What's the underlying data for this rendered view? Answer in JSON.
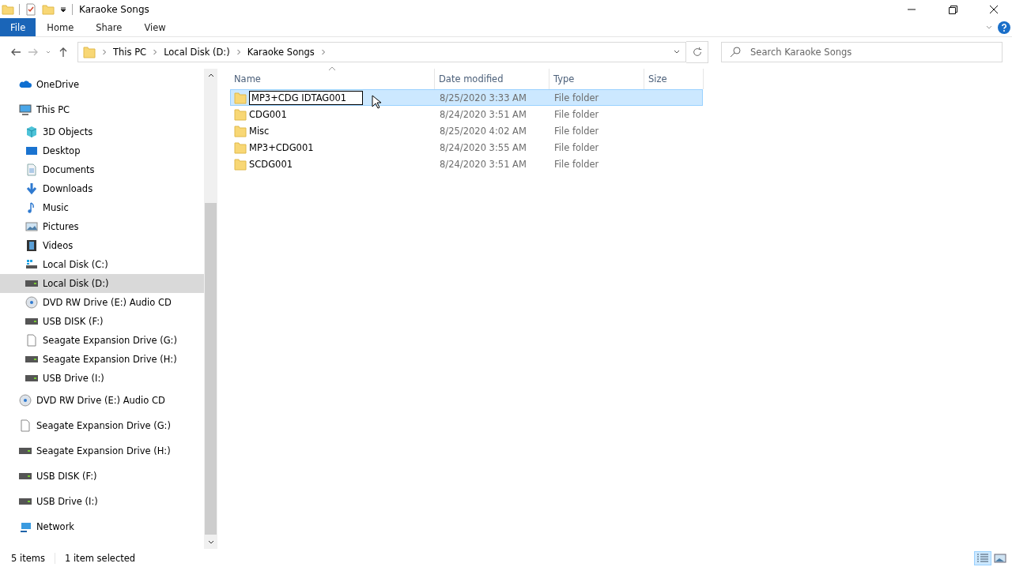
{
  "window": {
    "title": "Karaoke Songs"
  },
  "ribbon_tabs": [
    {
      "label": "File",
      "selected": true
    },
    {
      "label": "Home",
      "selected": false
    },
    {
      "label": "Share",
      "selected": false
    },
    {
      "label": "View",
      "selected": false
    }
  ],
  "address": {
    "path": [
      "This PC",
      "Local Disk (D:)",
      "Karaoke Songs"
    ]
  },
  "search": {
    "placeholder": "Search Karaoke Songs"
  },
  "sidebar": {
    "items": [
      {
        "label": "OneDrive",
        "kind": "cloud",
        "selected": false
      },
      {
        "label": "This PC",
        "kind": "computer",
        "selected": false,
        "children": [
          {
            "label": "3D Objects",
            "kind": "objects",
            "selected": false
          },
          {
            "label": "Desktop",
            "kind": "desktop",
            "selected": false
          },
          {
            "label": "Documents",
            "kind": "documents",
            "selected": false
          },
          {
            "label": "Downloads",
            "kind": "downloads",
            "selected": false
          },
          {
            "label": "Music",
            "kind": "music",
            "selected": false
          },
          {
            "label": "Pictures",
            "kind": "pictures",
            "selected": false
          },
          {
            "label": "Videos",
            "kind": "videos",
            "selected": false
          },
          {
            "label": "Local Disk (C:)",
            "kind": "system-drive",
            "selected": false
          },
          {
            "label": "Local Disk (D:)",
            "kind": "drive",
            "selected": true
          },
          {
            "label": "DVD RW Drive (E:) Audio CD",
            "kind": "optical-drive",
            "selected": false
          },
          {
            "label": "USB DISK (F:)",
            "kind": "drive",
            "selected": false
          },
          {
            "label": "Seagate Expansion Drive (G:)",
            "kind": "blank-drive",
            "selected": false
          },
          {
            "label": "Seagate Expansion Drive (H:)",
            "kind": "drive",
            "selected": false
          },
          {
            "label": "USB Drive (I:)",
            "kind": "drive",
            "selected": false
          }
        ]
      },
      {
        "label": "DVD RW Drive (E:) Audio CD",
        "kind": "optical-drive",
        "selected": false
      },
      {
        "label": "Seagate Expansion Drive (G:)",
        "kind": "blank-drive",
        "selected": false
      },
      {
        "label": "Seagate Expansion Drive (H:)",
        "kind": "drive",
        "selected": false
      },
      {
        "label": "USB DISK (F:)",
        "kind": "drive",
        "selected": false
      },
      {
        "label": "USB Drive (I:)",
        "kind": "drive",
        "selected": false
      },
      {
        "label": "Network",
        "kind": "network",
        "selected": false
      }
    ]
  },
  "table": {
    "columns": [
      "Name",
      "Date modified",
      "Type",
      "Size"
    ],
    "rows": [
      {
        "name": "MP3+CDG IDTAG001",
        "date": "8/25/2020 3:33 AM",
        "type": "File folder",
        "selected": true,
        "editing": true
      },
      {
        "name": "CDG001",
        "date": "8/24/2020 3:51 AM",
        "type": "File folder",
        "selected": false,
        "editing": false
      },
      {
        "name": "Misc",
        "date": "8/25/2020 4:02 AM",
        "type": "File folder",
        "selected": false,
        "editing": false
      },
      {
        "name": "MP3+CDG001",
        "date": "8/24/2020 3:55 AM",
        "type": "File folder",
        "selected": false,
        "editing": false
      },
      {
        "name": "SCDG001",
        "date": "8/24/2020 3:51 AM",
        "type": "File folder",
        "selected": false,
        "editing": false
      }
    ]
  },
  "status_bar": {
    "count": "5 items",
    "selection": "1 item selected"
  },
  "view_buttons": [
    {
      "kind": "details",
      "selected": true
    },
    {
      "kind": "thumbnails",
      "selected": false
    }
  ]
}
